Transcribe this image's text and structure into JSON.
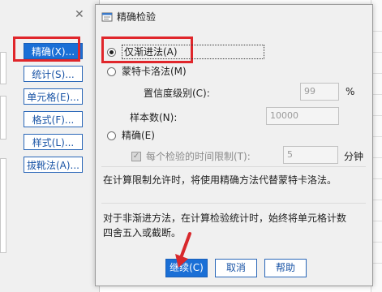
{
  "background_dialog": {
    "buttons": [
      {
        "label": "精确(X)..."
      },
      {
        "label": "统计(S)..."
      },
      {
        "label": "单元格(E)..."
      },
      {
        "label": "格式(F)..."
      },
      {
        "label": "样式(L)..."
      },
      {
        "label": "拔靴法(A)..."
      }
    ]
  },
  "dialog": {
    "title": "精确检验",
    "option_asymptotic": "仅渐进法(A)",
    "option_monte_carlo": "蒙特卡洛法(M)",
    "confidence_label": "置信度级别(C):",
    "confidence_value": "99",
    "confidence_unit": "%",
    "samples_label": "样本数(N):",
    "samples_value": "10000",
    "option_exact": "精确(E)",
    "time_limit_label": "每个检验的时间限制(T):",
    "time_limit_value": "5",
    "time_limit_unit": "分钟",
    "note1": "在计算限制允许时，将使用精确方法代替蒙特卡洛法。",
    "note2_line1": "对于非渐进方法，在计算检验统计时，始终将单元格计数",
    "note2_line2": "四舍五入或截断。",
    "buttons": {
      "continue": "继续(C)",
      "cancel": "取消",
      "help": "帮助"
    },
    "selected_option": "仅渐进法(A)"
  },
  "colors": {
    "accent": "#1a6fd6",
    "highlight": "#e0262b",
    "arrow": "#d8282c"
  },
  "icons": [
    "close-icon",
    "dialog-icon",
    "radio-icon",
    "checkbox-icon",
    "arrow-icon"
  ]
}
